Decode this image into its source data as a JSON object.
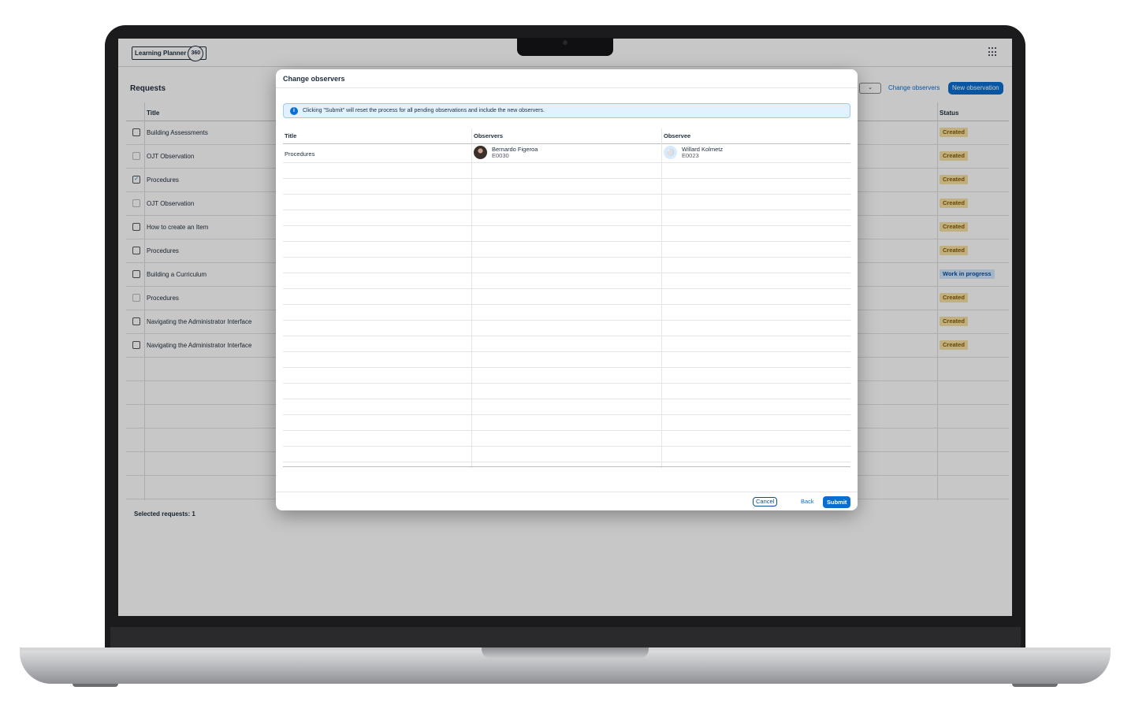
{
  "app": {
    "logo_text": "Learning Planner",
    "logo_badge": "360"
  },
  "requests": {
    "title": "Requests",
    "toolbar": {
      "change_observers_label": "Change observers",
      "new_observation_label": "New observation"
    },
    "columns": {
      "title": "Title",
      "status": "Status"
    },
    "rows": [
      {
        "title": "Building Assessments",
        "status": "Created",
        "checked": false,
        "disabled": false
      },
      {
        "title": "OJT Observation",
        "status": "Created",
        "checked": false,
        "disabled": true
      },
      {
        "title": "Procedures",
        "status": "Created",
        "checked": true,
        "disabled": false
      },
      {
        "title": "OJT Observation",
        "status": "Created",
        "checked": false,
        "disabled": true
      },
      {
        "title": "How to create an Item",
        "status": "Created",
        "checked": false,
        "disabled": false
      },
      {
        "title": "Procedures",
        "status": "Created",
        "checked": false,
        "disabled": false
      },
      {
        "title": "Building a Curriculum",
        "status": "Work in progress",
        "checked": false,
        "disabled": false
      },
      {
        "title": "Procedures",
        "status": "Created",
        "checked": false,
        "disabled": true
      },
      {
        "title": "Navigating the Administrator Interface",
        "status": "Created",
        "checked": false,
        "disabled": false
      },
      {
        "title": "Navigating the Administrator Interface",
        "status": "Created",
        "checked": false,
        "disabled": false
      }
    ],
    "selected_label": "Selected requests: 1"
  },
  "dialog": {
    "title": "Change observers",
    "info_message": "Clicking \"Submit\" will reset the process for all pending observations and include the new observers.",
    "columns": {
      "title": "Title",
      "observers": "Observers",
      "observee": "Observee"
    },
    "rows": [
      {
        "title": "Procedures",
        "observer": {
          "name": "Bernardo Figeroa",
          "id": "E0030"
        },
        "observee": {
          "name": "Willard Kolmetz",
          "id": "E0023"
        }
      }
    ],
    "buttons": {
      "cancel": "Cancel",
      "back": "Back",
      "submit": "Submit"
    }
  },
  "colors": {
    "accent": "#0a6ed1",
    "created_badge": "#f6e0a3",
    "wip_badge": "#d1e8ff"
  },
  "icons": {
    "info": "info-icon",
    "apps": "apps-grid-icon",
    "person": "person-icon"
  }
}
